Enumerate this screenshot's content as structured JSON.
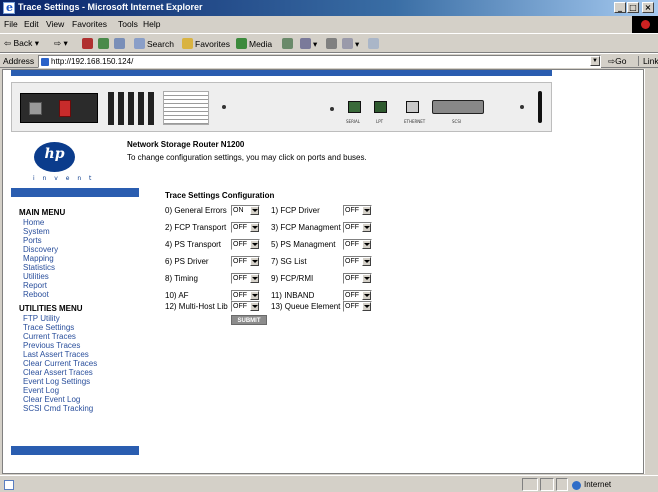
{
  "window": {
    "title": "Trace Settings - Microsoft Internet Explorer",
    "controls": [
      "_",
      "□",
      "×"
    ]
  },
  "menubar": [
    "File",
    "Edit",
    "View",
    "Favorites",
    "Tools",
    "Help"
  ],
  "toolbar": {
    "back": "Back",
    "search": "Search",
    "favorites": "Favorites",
    "media": "Media"
  },
  "address": {
    "label": "Address",
    "url": "http://192.168.150.124/",
    "go": "Go",
    "links": "Links"
  },
  "page": {
    "product_title": "Network Storage Router N1200",
    "subtitle": "To change configuration settings, you may click on ports and buses.",
    "logo_text": "hp",
    "logo_tag": "i n v e n t",
    "router_labels": [
      "SERIAL",
      "LPT",
      "ETHERNET",
      "SCSI"
    ],
    "main_menu": {
      "heading": "MAIN MENU",
      "items": [
        "Home",
        "System",
        "Ports",
        "Discovery",
        "Mapping",
        "Statistics",
        "Utilities",
        "Report",
        "Reboot"
      ]
    },
    "utilities_menu": {
      "heading": "UTILITIES MENU",
      "items": [
        "FTP Utility",
        "Trace Settings",
        "Current Traces",
        "Previous Traces",
        "Last Assert Traces",
        "Clear Current Traces",
        "Clear Assert Traces",
        "Event Log Settings",
        "Event Log",
        "Clear Event Log",
        "SCSI Cmd Tracking"
      ]
    },
    "trace_config": {
      "heading": "Trace Settings Configuration",
      "options": [
        {
          "label": "0) General Errors",
          "value": "ON"
        },
        {
          "label": "1) FCP Driver",
          "value": "OFF"
        },
        {
          "label": "2) FCP Transport",
          "value": "OFF"
        },
        {
          "label": "3) FCP Managment",
          "value": "OFF"
        },
        {
          "label": "4) PS Transport",
          "value": "OFF"
        },
        {
          "label": "5) PS Managment",
          "value": "OFF"
        },
        {
          "label": "6) PS Driver",
          "value": "OFF"
        },
        {
          "label": "7) SG List",
          "value": "OFF"
        },
        {
          "label": "8) Timing",
          "value": "OFF"
        },
        {
          "label": "9) FCP/RMI",
          "value": "OFF"
        },
        {
          "label": "10) AF",
          "value": "OFF"
        },
        {
          "label": "11) INBAND",
          "value": "OFF"
        },
        {
          "label": "12) Multi-Host Lib",
          "value": "OFF"
        },
        {
          "label": "13) Queue Element",
          "value": "OFF"
        }
      ],
      "submit": "SUBMIT"
    }
  },
  "statusbar": {
    "zone": "Internet"
  },
  "colors": {
    "banner_blue": "#2a5db0",
    "link_blue": "#2a4f9c",
    "title_gradient_start": "#0a246a"
  }
}
